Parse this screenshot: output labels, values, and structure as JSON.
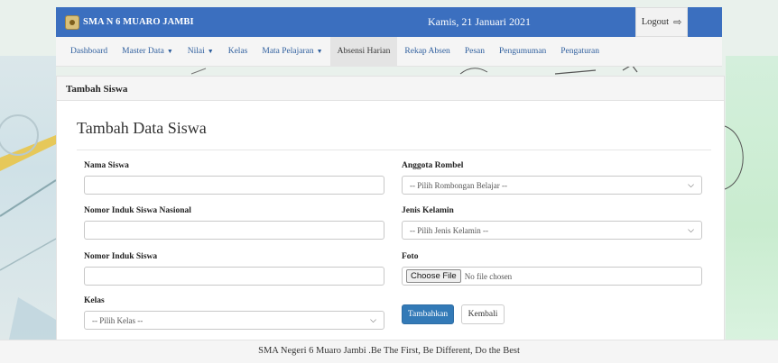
{
  "header": {
    "brand": "SMA N 6 MUARO JAMBI",
    "date": "Kamis, 21 Januari 2021",
    "logout_label": "Logout"
  },
  "menu": [
    {
      "label": "Dashboard",
      "dropdown": false
    },
    {
      "label": "Master Data",
      "dropdown": true
    },
    {
      "label": "Nilai",
      "dropdown": true
    },
    {
      "label": "Kelas",
      "dropdown": false
    },
    {
      "label": "Mata Pelajaran",
      "dropdown": true
    },
    {
      "label": "Absensi Harian",
      "dropdown": false,
      "active": true
    },
    {
      "label": "Rekap Absen",
      "dropdown": false
    },
    {
      "label": "Pesan",
      "dropdown": false
    },
    {
      "label": "Pengumuman",
      "dropdown": false
    },
    {
      "label": "Pengaturan",
      "dropdown": false
    }
  ],
  "panel": {
    "heading": "Tambah Siswa",
    "title": "Tambah Data Siswa"
  },
  "form": {
    "nama_label": "Nama Siswa",
    "nama_value": "",
    "nisn_label": "Nomor Induk Siswa Nasional",
    "nisn_value": "",
    "nis_label": "Nomor Induk Siswa",
    "nis_value": "",
    "kelas_label": "Kelas",
    "kelas_selected": "-- Pilih Kelas --",
    "rombel_label": "Anggota Rombel",
    "rombel_selected": "-- Pilih Rombongan Belajar --",
    "jk_label": "Jenis Kelamin",
    "jk_selected": "-- Pilih Jenis Kelamin --",
    "foto_label": "Foto",
    "file_button": "Choose File",
    "file_status": "No file chosen",
    "submit_label": "Tambahkan",
    "back_label": "Kembali"
  },
  "footer": {
    "text": "SMA Negeri 6 Muaro Jambi .Be The First, Be Different, Do the Best"
  },
  "colors": {
    "navbar": "#3b6fbf",
    "primary_button": "#337ab7",
    "link": "#2f5f9e"
  },
  "icons": {
    "logout": "sign-out-icon",
    "caret": "caret-down-icon",
    "select": "chevron-down-icon"
  }
}
